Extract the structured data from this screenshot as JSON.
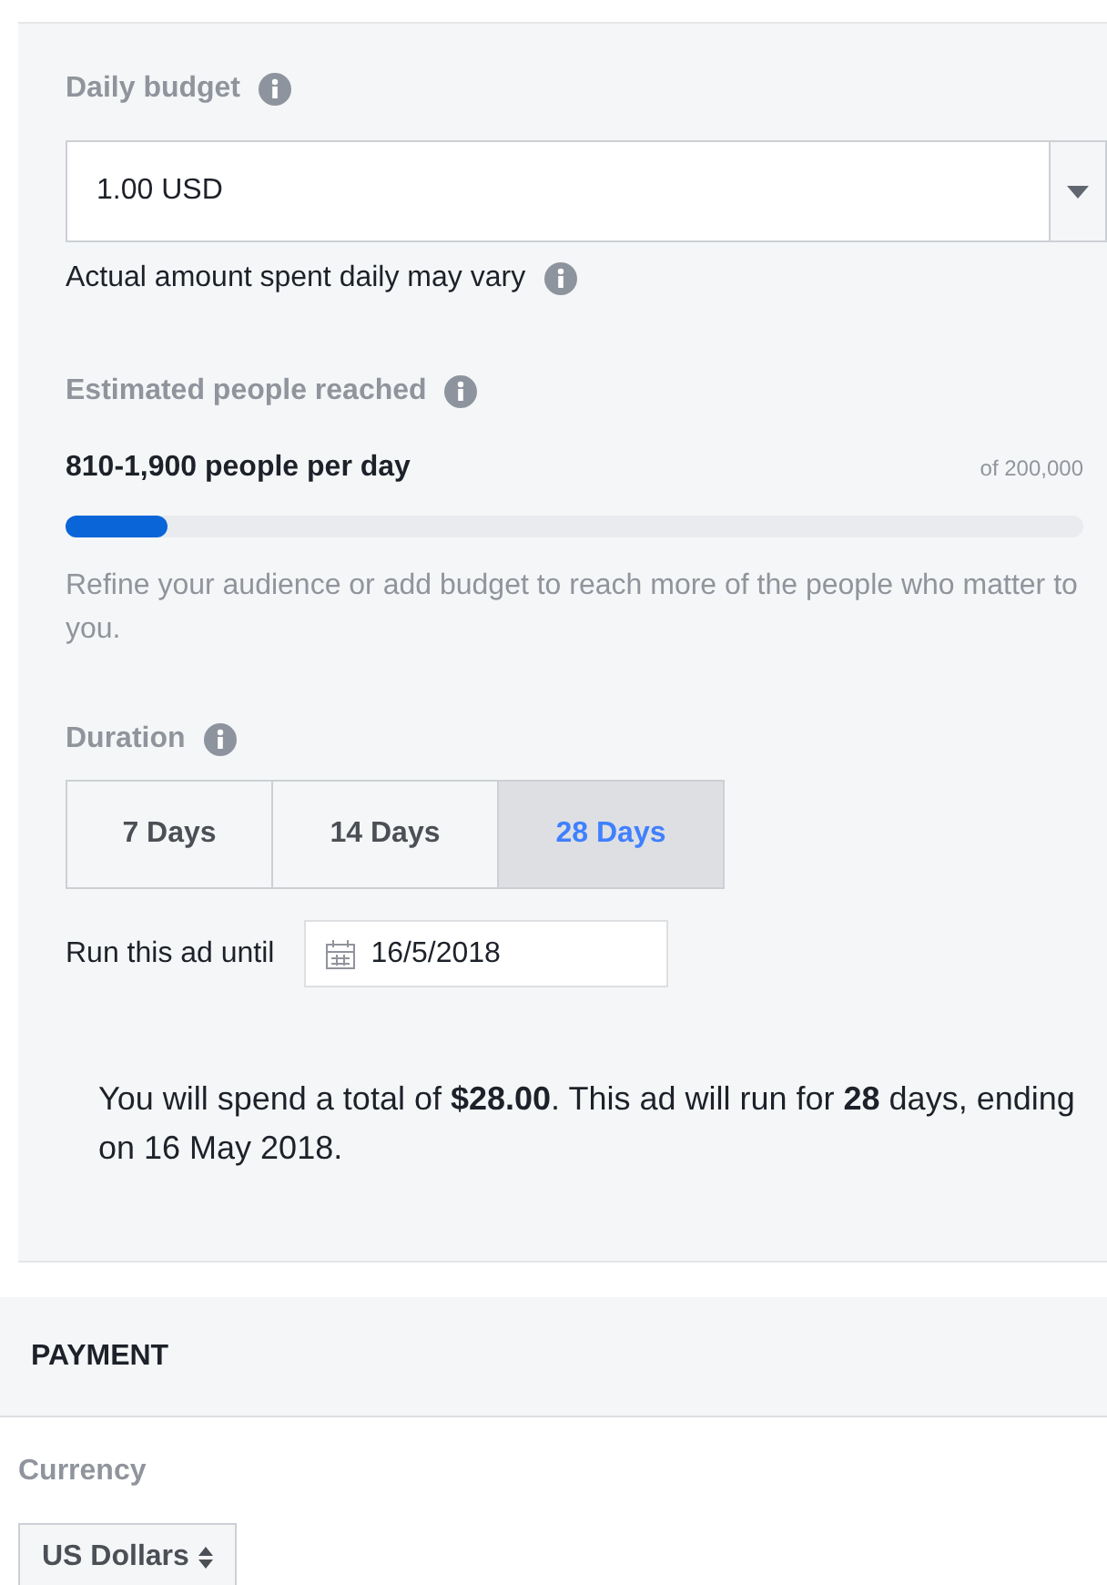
{
  "budget": {
    "label": "Daily budget",
    "value": "1.00 USD",
    "note": "Actual amount spent daily may vary"
  },
  "reach": {
    "label": "Estimated people reached",
    "estimate": "810-1,900 people per day",
    "total": "of 200,000",
    "level": 0.1,
    "hint": "Refine your audience or add budget to reach more of the people who matter to you."
  },
  "duration": {
    "label": "Duration",
    "options": [
      {
        "label": "7 Days",
        "selected": false
      },
      {
        "label": "14 Days",
        "selected": false
      },
      {
        "label": "28 Days",
        "selected": true
      }
    ],
    "end_label": "Run this ad until",
    "end_date": "16/5/2018"
  },
  "summary": "You will spend a total of **$28.00**. This ad will run for **28** days, ending on 16 May 2018.",
  "payment": {
    "title": "PAYMENT",
    "currency_label": "Currency",
    "currency": "US Dollars"
  }
}
